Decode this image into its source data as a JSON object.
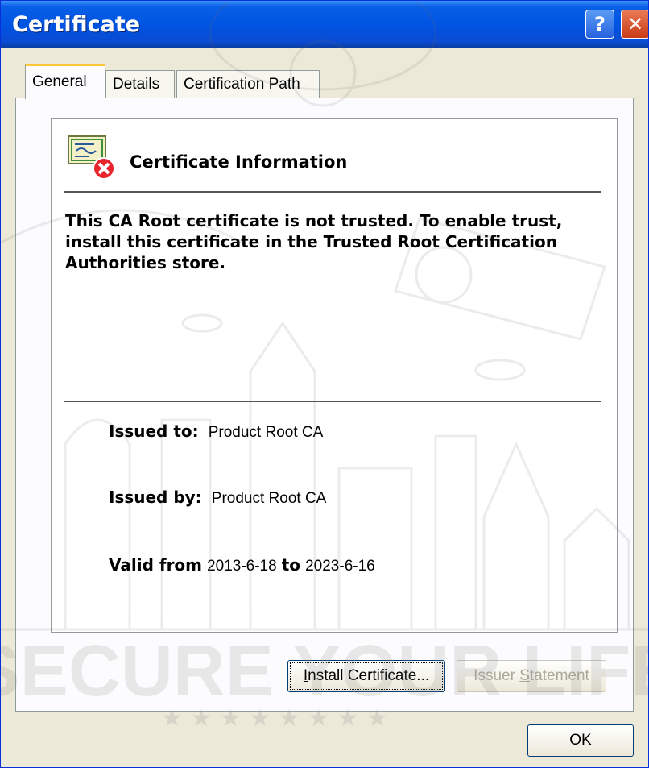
{
  "window": {
    "title": "Certificate",
    "help_label": "?",
    "close_label": "✕"
  },
  "tabs": [
    {
      "label": "General",
      "active": true
    },
    {
      "label": "Details",
      "active": false
    },
    {
      "label": "Certification Path",
      "active": false
    }
  ],
  "general": {
    "info_title": "Certificate Information",
    "message": "This CA Root certificate is not trusted. To enable trust, install this certificate in the Trusted Root Certification Authorities store.",
    "issued_to_label": "Issued to:",
    "issued_to_value": "Product Root CA",
    "issued_by_label": "Issued by:",
    "issued_by_value": "Product Root CA",
    "valid_from_label": "Valid from",
    "valid_from_value": "2013-6-18",
    "valid_to_label": "to",
    "valid_to_value": "2023-6-16"
  },
  "buttons": {
    "install_first": "I",
    "install_rest": "nstall Certificate...",
    "issuer_pre": "Issuer ",
    "issuer_acc": "S",
    "issuer_post": "tatement",
    "ok": "OK"
  },
  "watermark": {
    "text": "SECURE YOUR LIFE",
    "stars": "★ ★ ★ ★ ★ ★ ★ ★"
  },
  "colors": {
    "titlebar": "#0054e3",
    "dialog_bg": "#ece9d8",
    "active_tab_accent": "#ffc83c",
    "error_icon": "#e8242c"
  }
}
